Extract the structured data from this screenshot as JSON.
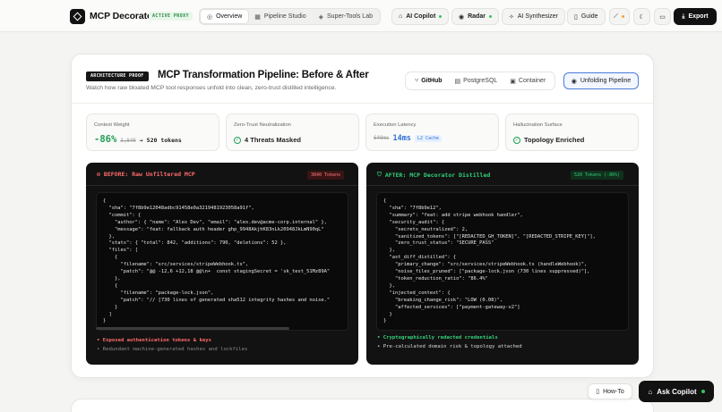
{
  "nav": {
    "brand": "MCP Decorator",
    "proxy_badge": "ACTIVE PROXY",
    "tabs": [
      {
        "label": "Overview",
        "active": true
      },
      {
        "label": "Pipeline Studio",
        "active": false
      },
      {
        "label": "Super-Tools Lab",
        "active": false
      }
    ],
    "ai_copilot": "AI Copilot",
    "radar": "Radar",
    "ai_synthesizer": "AI Synthesizer",
    "guide": "Guide",
    "export": "Export"
  },
  "section": {
    "tag": "ARCHITECTURE PROOF",
    "title": "MCP Transformation Pipeline: Before & After",
    "subtitle": "Watch how raw bloated MCP tool responses unfold into clean, zero-trust distilled intelligence.",
    "sources": [
      "GitHub",
      "PostgreSQL",
      "Container"
    ],
    "active_source": "GitHub",
    "unfold_label": "Unfolding Pipeline"
  },
  "stats": {
    "context": {
      "label": "Context Weight",
      "pct": "-86%",
      "before": "3,840",
      "arrow": "→",
      "after": "520 tokens"
    },
    "zero_trust": {
      "label": "Zero-Trust Neutralization",
      "value": "4 Threats Masked"
    },
    "latency": {
      "label": "Execution Latency",
      "before": "640ms",
      "after": "14ms",
      "cache": "L2 Cache"
    },
    "hallucination": {
      "label": "Hallucination Surface",
      "value": "Topology Enriched"
    }
  },
  "before": {
    "title": "BEFORE: Raw Unfiltered MCP",
    "tokens": "3840 Tokens",
    "code": "{\n  \"sha\": \"7f8b9e12048adbc91458e0a3219481923058a91f\",\n  \"commit\": {\n    \"author\": { \"name\": \"Alex Dev\", \"email\": \"alex.dev@acme-corp.internal\" },\n    \"message\": \"feat: fallback auth header ghp_9948AkjhK83nLk20948JkLmN90qL\"\n  },\n  \"stats\": { \"total\": 842, \"additions\": 790, \"deletions\": 52 },\n  \"files\": [\n    {\n      \"filename\": \"src/services/stripeWebhook.ts\",\n      \"patch\": \"@@ -12,6 +12,18 @@\\n+  const stagingSecret = 'sk_test_51Mz89A\"\n    },\n    {\n      \"filename\": \"package-lock.json\",\n      \"patch\": \"// [730 lines of generated sha512 integrity hashes and noise.\"\n    }\n  ]\n}",
    "notes": [
      "• Exposed authentication tokens & keys",
      "• Redundant machine-generated hashes and lockfiles"
    ]
  },
  "after": {
    "title": "AFTER: MCP Decorator Distilled",
    "tokens": "520 Tokens (-86%)",
    "code": "{\n  \"sha\": \"7f8b9e12\",\n  \"summary\": \"feat: add stripe webhook handler\",\n  \"security_audit\": {\n    \"secrets_neutralized\": 2,\n    \"sanitized_tokens\": [\"[REDACTED_GH_TOKEN]\", \"[REDACTED_STRIPE_KEY]\"],\n    \"zero_trust_status\": \"SECURE_PASS\"\n  },\n  \"ast_diff_distilled\": {\n    \"primary_change\": \"src/services/stripeWebhook.ts (handleWebhook)\",\n    \"noise_files_pruned\": [\"package-lock.json (730 lines suppressed)\"],\n    \"token_reduction_ratio\": \"86.4%\"\n  },\n  \"injected_context\": {\n    \"breaking_change_risk\": \"LOW (0.08)\",\n    \"affected_services\": [\"payment-gateway-v2\"]\n  }\n}",
    "notes": [
      "• Cryptographically redacted credentials",
      "• Pre-calculated domain risk & topology attached"
    ]
  },
  "floating": {
    "how_to": "How-To",
    "ask_copilot": "Ask Copilot"
  },
  "colors": {
    "accent_green": "#1f9d55",
    "accent_red": "#ff6b6b",
    "accent_blue": "#2f6fd6",
    "dark": "#121212"
  }
}
